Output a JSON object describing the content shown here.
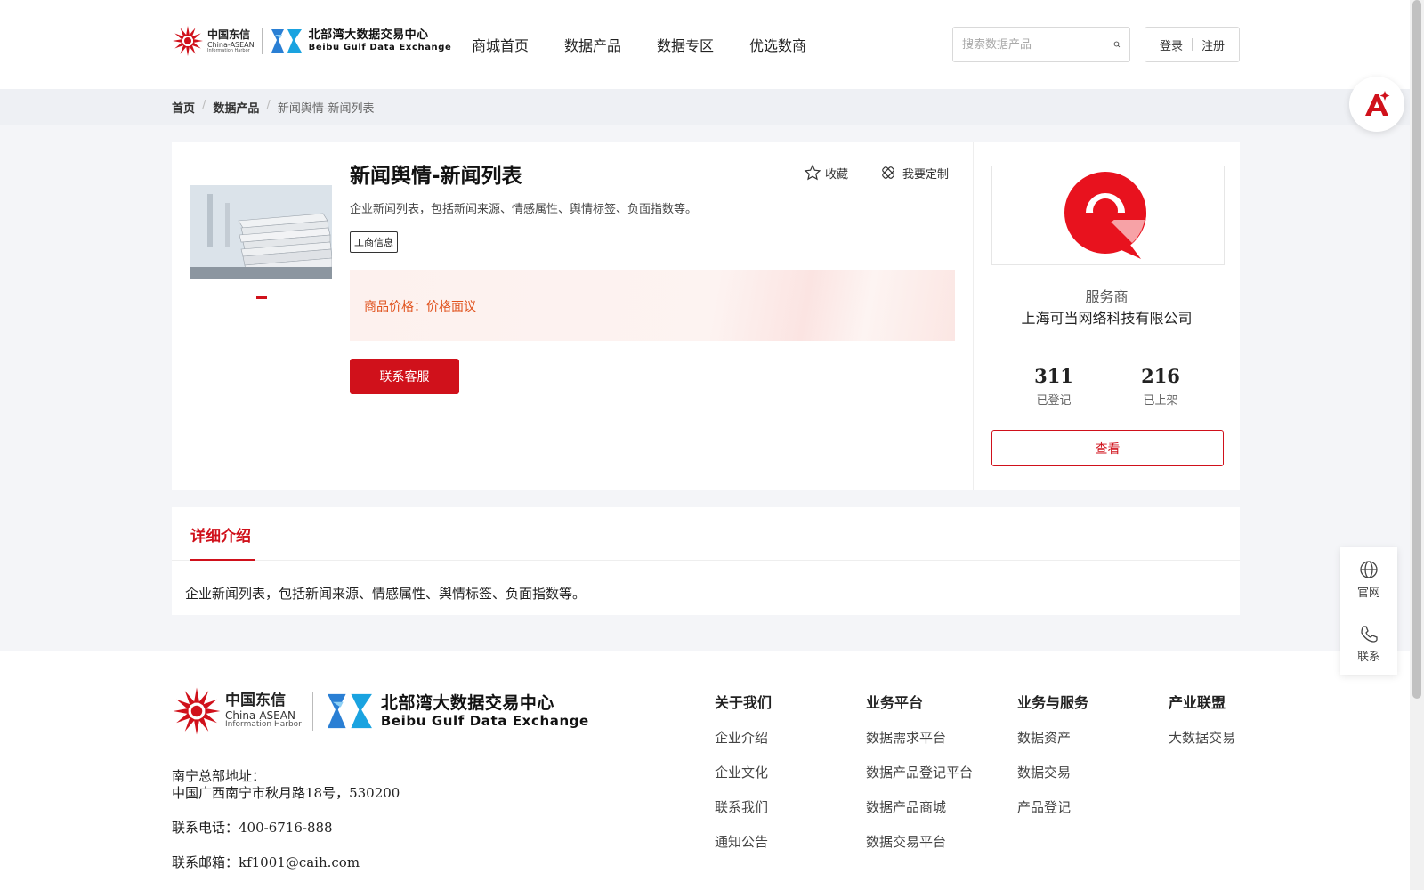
{
  "header": {
    "logo_cn": {
      "title": "中国东信",
      "sub1": "China-ASEAN",
      "sub2": "Information Harbor"
    },
    "logo_bg": {
      "title": "北部湾大数据交易中心",
      "sub": "Beibu Gulf Data Exchange"
    },
    "nav": [
      "商城首页",
      "数据产品",
      "数据专区",
      "优选数商"
    ],
    "search": {
      "placeholder": "搜索数据产品",
      "value": ""
    },
    "login": "登录",
    "register": "注册"
  },
  "breadcrumb": [
    "首页",
    "数据产品",
    "新闻舆情-新闻列表"
  ],
  "product": {
    "title": "新闻舆情-新闻列表",
    "favorite": "收藏",
    "customize": "我要定制",
    "description": "企业新闻列表，包括新闻来源、情感属性、舆情标签、负面指数等。",
    "tag": "工商信息",
    "price_label": "商品价格：",
    "price_value": "价格面议",
    "contact_button": "联系客服"
  },
  "provider": {
    "label": "服务商",
    "name": "上海可当网络科技有限公司",
    "registered_count": "311",
    "registered_label": "已登记",
    "listed_count": "216",
    "listed_label": "已上架",
    "view_button": "查看"
  },
  "detail": {
    "tab": "详细介绍",
    "text": "企业新闻列表，包括新闻来源、情感属性、舆情标签、负面指数等。"
  },
  "footer": {
    "address_label": "南宁总部地址：",
    "address": "中国广西南宁市秋月路18号，530200",
    "phone": "联系电话：400-6716-888",
    "email": "联系邮箱：kf1001@caih.com",
    "columns": [
      {
        "heading": "关于我们",
        "items": [
          "企业介绍",
          "企业文化",
          "联系我们",
          "通知公告"
        ]
      },
      {
        "heading": "业务平台",
        "items": [
          "数据需求平台",
          "数据产品登记平台",
          "数据产品商城",
          "数据交易平台"
        ]
      },
      {
        "heading": "业务与服务",
        "items": [
          "数据资产",
          "数据交易",
          "产品登记"
        ]
      },
      {
        "heading": "产业联盟",
        "items": [
          "大数据交易"
        ]
      }
    ]
  },
  "side": {
    "website": "官网",
    "contact": "联系"
  },
  "colors": {
    "brand_red": "#d0111b",
    "price_orange": "#e0501a"
  },
  "icons": [
    "search-icon",
    "star-icon",
    "customize-icon",
    "globe-icon",
    "phone-icon",
    "ai-assistant-icon"
  ]
}
